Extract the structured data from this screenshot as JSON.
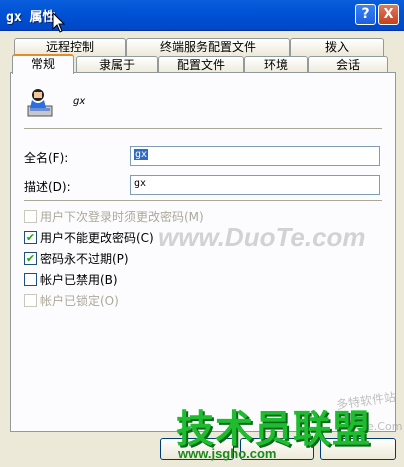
{
  "window": {
    "title": "gx 属性",
    "help_glyph": "?",
    "close_glyph": "X"
  },
  "tabs_row1": [
    "远程控制",
    "终端服务配置文件",
    "拨入"
  ],
  "tabs_row2": [
    "常规",
    "隶属于",
    "配置文件",
    "环境",
    "会话"
  ],
  "active_tab": "常规",
  "user": {
    "name": "gx",
    "icon": "user-account-icon"
  },
  "fields": {
    "full_name_label": "全名(F):",
    "full_name_value": "gx",
    "description_label": "描述(D):",
    "description_value": "gx"
  },
  "options": [
    {
      "label": "用户下次登录时须更改密码(M)",
      "checked": false,
      "disabled": true
    },
    {
      "label": "用户不能更改密码(C)",
      "checked": true,
      "disabled": false
    },
    {
      "label": "密码永不过期(P)",
      "checked": true,
      "disabled": false
    },
    {
      "label": "帐户已禁用(B)",
      "checked": false,
      "disabled": false
    },
    {
      "label": "帐户已锁定(O)",
      "checked": false,
      "disabled": true
    }
  ],
  "watermarks": {
    "main": "www.DuoTe.com",
    "logo": "技术员联盟",
    "url": "www.jsgho.com",
    "small1": "多特软件站",
    "small2": "DuoTe.Com"
  }
}
